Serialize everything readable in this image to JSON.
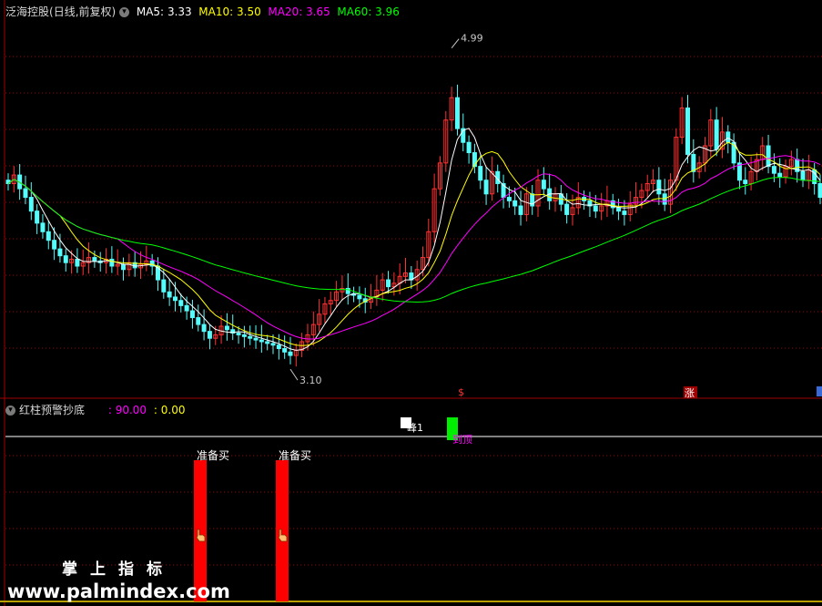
{
  "main_panel": {
    "stock_name": "泛海控股",
    "period_label": "(日线,前复权)",
    "ma5_label": "MA5:",
    "ma5_value": "3.33",
    "ma10_label": "MA10:",
    "ma10_value": "3.50",
    "ma20_label": "MA20:",
    "ma20_value": "3.65",
    "ma60_label": "MA60:",
    "ma60_value": "3.96",
    "high_mark": "4.99",
    "low_mark": "3.10",
    "event_marker_1": "$",
    "event_marker_2": "涨"
  },
  "indicator_panel": {
    "name": "红柱预警抄底",
    "value_1": ": 90.00",
    "value_2": ": 0.00",
    "peak_label": "峰1",
    "top_label": "到顶",
    "signal_label_1": "准备买",
    "signal_label_2": "准备买"
  },
  "watermark": {
    "cn_text": "掌上指标",
    "url": "www.palmindex.com"
  },
  "colors": {
    "background": "#000000",
    "up_candle": "#ff3232",
    "down_candle": "#54fcfc",
    "ma5": "#ffffff",
    "ma10": "#ffff00",
    "ma20": "#ff00ff",
    "ma60": "#00ff00",
    "panel_border": "#a00000",
    "signal_bar": "#ff0000"
  },
  "chart_data": {
    "type": "candlestick",
    "price_range": [
      3.0,
      5.1
    ],
    "ma_latest": {
      "MA5": 3.33,
      "MA10": 3.5,
      "MA20": 3.65,
      "MA60": 3.96
    },
    "highest": 4.99,
    "lowest": 3.1,
    "closes": [
      4.18,
      4.23,
      4.15,
      4.1,
      4.02,
      3.95,
      3.9,
      3.85,
      3.8,
      3.76,
      3.72,
      3.74,
      3.7,
      3.72,
      3.75,
      3.73,
      3.72,
      3.74,
      3.7,
      3.71,
      3.68,
      3.72,
      3.69,
      3.71,
      3.73,
      3.7,
      3.62,
      3.55,
      3.52,
      3.5,
      3.47,
      3.44,
      3.4,
      3.36,
      3.32,
      3.28,
      3.3,
      3.35,
      3.33,
      3.31,
      3.3,
      3.29,
      3.28,
      3.27,
      3.26,
      3.25,
      3.24,
      3.22,
      3.2,
      3.18,
      3.21,
      3.26,
      3.3,
      3.36,
      3.42,
      3.48,
      3.5,
      3.55,
      3.57,
      3.54,
      3.53,
      3.51,
      3.49,
      3.52,
      3.56,
      3.62,
      3.58,
      3.6,
      3.64,
      3.66,
      3.62,
      3.68,
      3.75,
      3.9,
      4.15,
      4.3,
      4.55,
      4.68,
      4.5,
      4.42,
      4.36,
      4.28,
      4.2,
      4.12,
      4.25,
      4.18,
      4.1,
      4.08,
      4.05,
      4.0,
      4.12,
      4.05,
      4.2,
      4.15,
      4.08,
      4.12,
      4.06,
      4.0,
      4.04,
      4.1,
      4.08,
      4.05,
      4.02,
      4.05,
      4.08,
      4.04,
      4.02,
      4.0,
      4.06,
      4.1,
      4.14,
      4.18,
      4.2,
      4.12,
      4.06,
      4.2,
      4.45,
      4.62,
      4.35,
      4.25,
      4.3,
      4.4,
      4.55,
      4.38,
      4.48,
      4.42,
      4.3,
      4.2,
      4.18,
      4.25,
      4.32,
      4.4,
      4.28,
      4.24,
      4.22,
      4.28,
      4.32,
      4.25,
      4.2,
      4.26,
      4.18,
      4.1
    ],
    "signal_bars": [
      {
        "bar_index": 49,
        "value": 90.0,
        "label": "准备买"
      },
      {
        "bar_index": 68,
        "value": 90.0,
        "label": "准备买"
      }
    ],
    "indicator_values": [
      90.0,
      0.0
    ]
  }
}
